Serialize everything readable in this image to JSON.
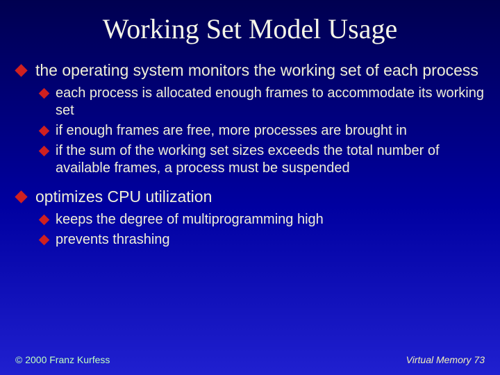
{
  "title": "Working Set Model Usage",
  "bullets": {
    "b1a": "the operating system monitors the working set of each process",
    "b1a_sub1": "each process is allocated enough frames to accommodate its working set",
    "b1a_sub2": "if enough frames are free, more processes are brought in",
    "b1a_sub3": "if the sum of the working set sizes exceeds the total number of available frames, a process must be suspended",
    "b1b": "optimizes CPU utilization",
    "b1b_sub1": "keeps the degree of multiprogramming high",
    "b1b_sub2": "prevents thrashing"
  },
  "footer": {
    "copyright": "© 2000 Franz Kurfess",
    "page": "Virtual Memory 73"
  }
}
